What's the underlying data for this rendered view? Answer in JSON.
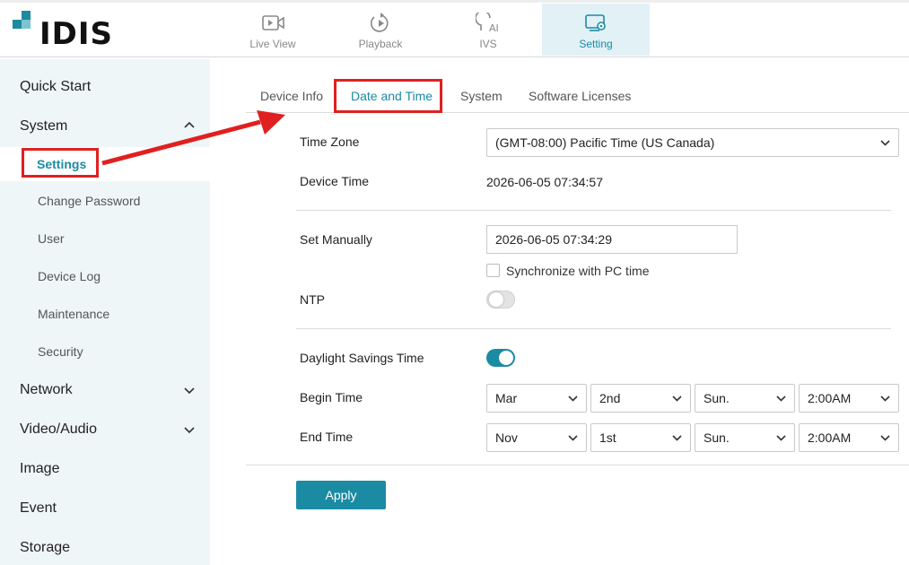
{
  "logo": {
    "text": "IDIS"
  },
  "nav": {
    "tabs": [
      {
        "label": "Live View",
        "icon": "live-view-icon"
      },
      {
        "label": "Playback",
        "icon": "playback-icon"
      },
      {
        "label": "IVS",
        "icon": "ivs-ai-icon"
      },
      {
        "label": "Setting",
        "icon": "setting-icon"
      }
    ],
    "active": "Setting"
  },
  "sidebar": {
    "items": [
      {
        "label": "Quick Start"
      },
      {
        "label": "System",
        "expanded": true
      },
      {
        "label": "Network"
      },
      {
        "label": "Video/Audio"
      },
      {
        "label": "Image"
      },
      {
        "label": "Event"
      },
      {
        "label": "Storage"
      }
    ],
    "system_sub": [
      {
        "label": "Settings",
        "active": true
      },
      {
        "label": "Change Password"
      },
      {
        "label": "User"
      },
      {
        "label": "Device Log"
      },
      {
        "label": "Maintenance"
      },
      {
        "label": "Security"
      }
    ]
  },
  "tabs": [
    {
      "label": "Device Info"
    },
    {
      "label": "Date and Time",
      "active": true
    },
    {
      "label": "System"
    },
    {
      "label": "Software Licenses"
    }
  ],
  "form": {
    "time_zone_label": "Time Zone",
    "time_zone_value": "(GMT-08:00) Pacific Time (US  Canada)",
    "device_time_label": "Device Time",
    "device_time_value": "2026-06-05 07:34:57",
    "set_manually_label": "Set Manually",
    "set_manually_value": "2026-06-05 07:34:29",
    "sync_pc_label": "Synchronize with PC time",
    "sync_pc_checked": false,
    "ntp_label": "NTP",
    "ntp_enabled": false,
    "dst_label": "Daylight Savings Time",
    "dst_enabled": true,
    "begin_label": "Begin Time",
    "begin": {
      "month": "Mar",
      "week": "2nd",
      "day": "Sun.",
      "time": "2:00AM"
    },
    "end_label": "End Time",
    "end": {
      "month": "Nov",
      "week": "1st",
      "day": "Sun.",
      "time": "2:00AM"
    },
    "apply_label": "Apply"
  },
  "colors": {
    "accent": "#1b8ba3",
    "highlight": "#e02020",
    "sidebar_bg": "#eef6f7"
  }
}
